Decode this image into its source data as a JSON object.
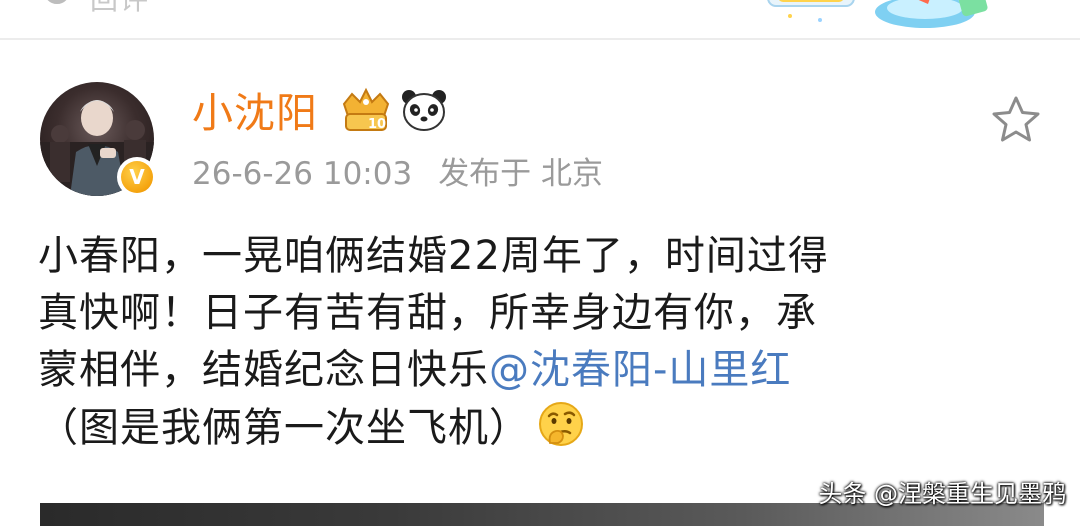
{
  "top_bar": {
    "left_icon": "comment-icon",
    "left_text": "回评",
    "promo_icon": "promo-banner-icon"
  },
  "user": {
    "name": "小沈阳",
    "avatar_icon": "avatar-image",
    "verified_icon": "verified-v-icon",
    "verified_text": "V",
    "level_icon": "crown-level-badge-icon",
    "level_number": "10",
    "panda_icon": "panda-badge-icon",
    "favorite_icon": "star-icon"
  },
  "meta": {
    "time": "26-6-26 10:03",
    "location": "发布于 北京"
  },
  "post": {
    "line1": "小春阳，一晃咱俩结婚22周年了，时间过得",
    "line2": "真快啊！日子有苦有甜，所幸身边有你，承",
    "line3_text": "蒙相伴，结婚纪念日快乐",
    "mention": "@沈春阳-山里红",
    "line4_text": "（图是我俩第一次坐飞机）",
    "emoji_icon": "thinking-emoji-icon"
  },
  "watermark": "头条 @涅槃重生见墨鸦",
  "colors": {
    "username": "#f07a17",
    "mention": "#4a7bbf",
    "meta": "#9a9a9a",
    "text": "#1a1a1a"
  }
}
